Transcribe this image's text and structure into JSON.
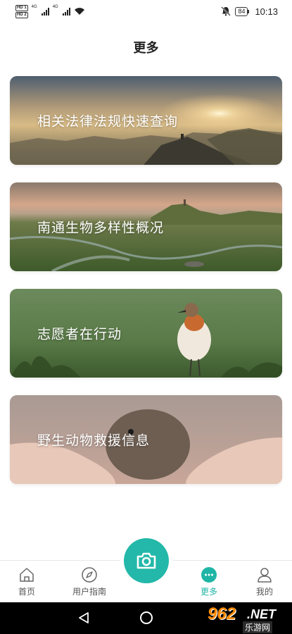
{
  "status_bar": {
    "hd1": "HD 1",
    "hd2": "HD 2",
    "network1": "4G",
    "network2": "4G",
    "battery": "84",
    "time": "10:13"
  },
  "header": {
    "title": "更多"
  },
  "cards": [
    {
      "label": "相关法律法规快速查询"
    },
    {
      "label": "南通生物多样性概况"
    },
    {
      "label": "志愿者在行动"
    },
    {
      "label": "野生动物救援信息"
    }
  ],
  "bottom_nav": {
    "items": [
      {
        "label": "首页",
        "icon": "home-icon",
        "active": false
      },
      {
        "label": "用户指南",
        "icon": "compass-icon",
        "active": false
      },
      {
        "label": "更多",
        "icon": "more-dots-icon",
        "active": true
      },
      {
        "label": "我的",
        "icon": "user-icon",
        "active": false
      }
    ],
    "center_button_icon": "camera-icon"
  },
  "watermark": {
    "num": "962",
    "net": ".NET",
    "sub": "乐游网"
  },
  "colors": {
    "accent": "#23b8a9",
    "active_label": "#1fb5a6"
  }
}
